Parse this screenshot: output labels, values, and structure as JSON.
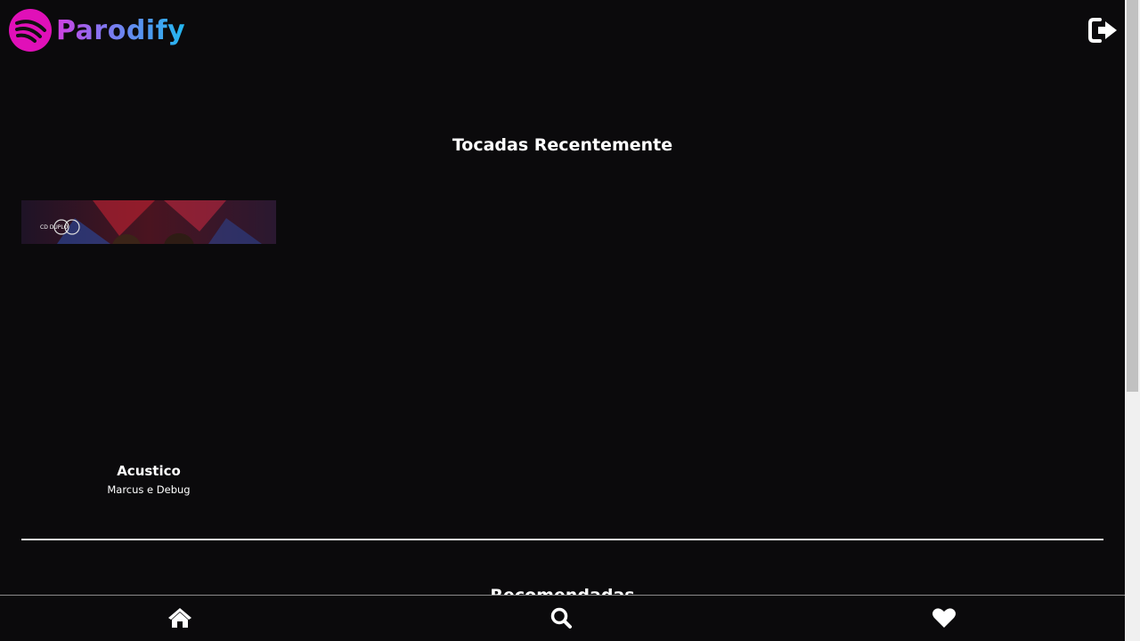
{
  "app": {
    "name": "Parodify"
  },
  "header": {
    "logo_icon": "parodify-logo-icon",
    "logout_icon": "sign-out-icon"
  },
  "recent": {
    "title": "Tocadas Recentemente",
    "albums": [
      {
        "title": "Acustico",
        "artist": "Marcus e Debug",
        "cover_text": "CD DUPLO"
      }
    ]
  },
  "next_section": {
    "title": "Recomendadas"
  },
  "bottom_nav": {
    "items": [
      {
        "icon": "home-icon"
      },
      {
        "icon": "search-icon"
      },
      {
        "icon": "heart-icon"
      }
    ]
  },
  "colors": {
    "background": "#0b0a0c",
    "logo_circle": "#e010b8",
    "logo_gradient_start": "#d13ee0",
    "logo_gradient_end": "#22b8f0"
  }
}
